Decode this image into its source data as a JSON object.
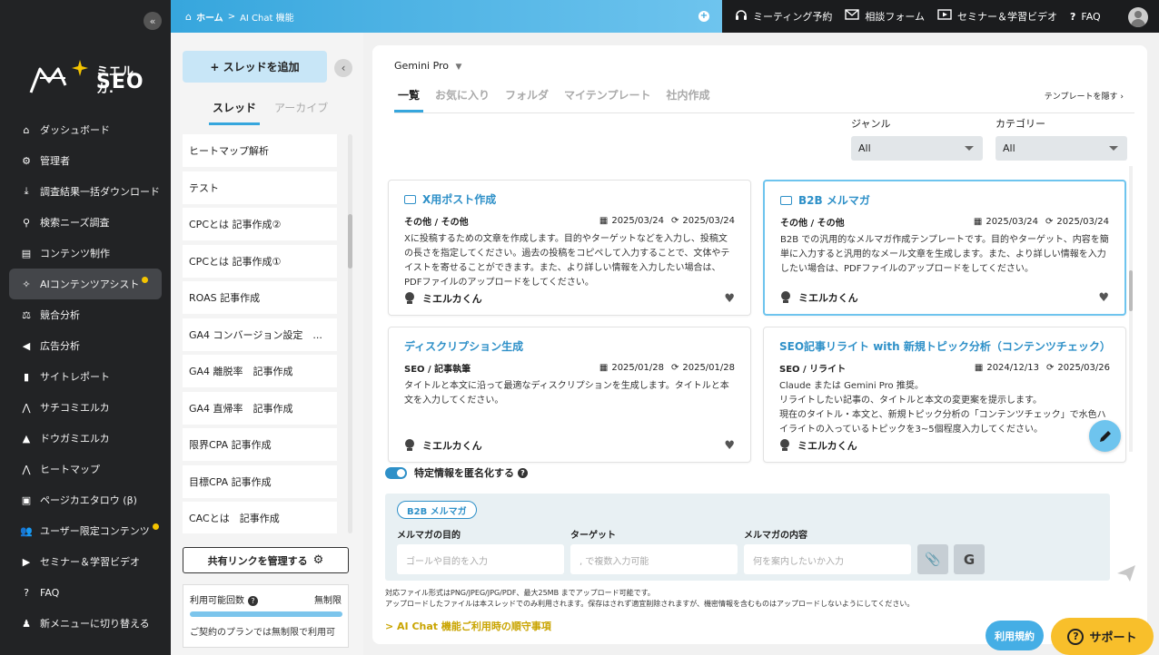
{
  "sidebar": {
    "collapse_glyph": "«",
    "logo_line1": "ミエルカ.",
    "logo_line2": "SEO",
    "items": [
      {
        "label": "ダッシュボード",
        "icon": "home-icon",
        "glyph": "⌂"
      },
      {
        "label": "管理者",
        "icon": "gear-icon",
        "glyph": "⚙"
      },
      {
        "label": "調査結果一括ダウンロード",
        "icon": "download-icon",
        "glyph": "⤓"
      },
      {
        "label": "検索ニーズ調査",
        "icon": "search-icon",
        "glyph": "⚲"
      },
      {
        "label": "コンテンツ制作",
        "icon": "document-icon",
        "glyph": "▤"
      },
      {
        "label": "AIコンテンツアシスト",
        "icon": "magic-wand-icon",
        "glyph": "✧"
      },
      {
        "label": "競合分析",
        "icon": "scale-icon",
        "glyph": "⚖"
      },
      {
        "label": "広告分析",
        "icon": "megaphone-icon",
        "glyph": "◀"
      },
      {
        "label": "サイトレポート",
        "icon": "bar-chart-icon",
        "glyph": "▮"
      },
      {
        "label": "サチコミエルカ",
        "icon": "sachiko-icon",
        "glyph": "⋀"
      },
      {
        "label": "ドウガミエルカ",
        "icon": "douga-icon",
        "glyph": "▲"
      },
      {
        "label": "ヒートマップ",
        "icon": "heatmap-icon",
        "glyph": "⋀"
      },
      {
        "label": "ページカエタロウ (β)",
        "icon": "page-edit-icon",
        "glyph": "▣"
      },
      {
        "label": "ユーザー限定コンテンツ",
        "icon": "users-icon",
        "glyph": "👥"
      },
      {
        "label": "セミナー＆学習ビデオ",
        "icon": "video-icon",
        "glyph": "▶"
      },
      {
        "label": "FAQ",
        "icon": "question-icon",
        "glyph": "?"
      },
      {
        "label": "新メニューに切り替える",
        "icon": "switch-icon",
        "glyph": "♟"
      }
    ]
  },
  "topbar": {
    "breadcrumb_home": "ホーム",
    "breadcrumb_sep": ">",
    "breadcrumb_current": "AI Chat 機能",
    "add_glyph": "+",
    "links": [
      {
        "label": "ミーティング予約",
        "icon": "headset-icon",
        "glyph": "🎧"
      },
      {
        "label": "相談フォーム",
        "icon": "mail-icon",
        "glyph": "✉"
      },
      {
        "label": "セミナー＆学習ビデオ",
        "icon": "video-icon",
        "glyph": "▶"
      },
      {
        "label": "FAQ",
        "icon": "question-icon",
        "glyph": "?"
      }
    ]
  },
  "threads": {
    "add_label": "+ スレッドを追加",
    "collapse_glyph": "‹",
    "tabs": [
      "スレッド",
      "アーカイブ"
    ],
    "items": [
      "ヒートマップ解析",
      "テスト",
      "CPCとは 記事作成②",
      "CPCとは 記事作成①",
      "ROAS 記事作成",
      "GA4 コンバージョン設定　...",
      "GA4 離脱率　記事作成",
      "GA4 直帰率　記事作成",
      "限界CPA 記事作成",
      "目標CPA 記事作成",
      "CACとは　記事作成"
    ],
    "share_label": "共有リンクを管理する",
    "usage_label": "利用可能回数",
    "usage_value": "無制限",
    "usage_note": "ご契約のプランでは無制限で利用可"
  },
  "main": {
    "model": "Gemini Pro",
    "tabs": [
      "一覧",
      "お気に入り",
      "フォルダ",
      "マイテンプレート",
      "社内作成"
    ],
    "hide_template": "テンプレートを隠す",
    "genre_label": "ジャンル",
    "genre_value": "All",
    "category_label": "カテゴリー",
    "category_value": "All",
    "cards": [
      {
        "title": "X用ポスト作成",
        "category": "その他 / その他",
        "created": "2025/03/24",
        "updated": "2025/03/24",
        "desc": "Xに投稿するための文章を作成します。目的やターゲットなどを入力し、投稿文の長さを指定してください。過去の投稿をコピペして入力することで、文体やテイストを寄せることができます。また、より詳しい情報を入力したい場合は、PDFファイルのアップロードをしてください。",
        "author": "ミエルカくん"
      },
      {
        "title": "B2B メルマガ",
        "category": "その他 / その他",
        "created": "2025/03/24",
        "updated": "2025/03/24",
        "desc": "B2B での汎用的なメルマガ作成テンプレートです。目的やターゲット、内容を簡単に入力すると汎用的なメール文章を生成します。また、より詳しい情報を入力したい場合は、PDFファイルのアップロードをしてください。",
        "author": "ミエルカくん"
      },
      {
        "title": "ディスクリプション生成",
        "category": "SEO / 記事執筆",
        "created": "2025/01/28",
        "updated": "2025/01/28",
        "desc": "タイトルと本文に沿って最適なディスクリプションを生成します。タイトルと本文を入力してください。",
        "author": "ミエルカくん"
      },
      {
        "title": "SEO記事リライト with 新規トピック分析（コンテンツチェック）",
        "category": "SEO / リライト",
        "created": "2024/12/13",
        "updated": "2025/03/26",
        "desc": "Claude または Gemini Pro 推奨。\nリライトしたい記事の、タイトルと本文の変更案を提示します。\n現在のタイトル・本文と、新規トピック分析の「コンテンツチェック」で水色ハイライトの入っているトピックを3~5個程度入力してください。",
        "author": "ミエルカくん"
      }
    ],
    "anonymize_label": "特定情報を匿名化する",
    "selected_chip": "B2B メルマガ",
    "fields": [
      {
        "label": "メルマガの目的",
        "placeholder": "ゴールや目的を入力"
      },
      {
        "label": "ターゲット",
        "placeholder": ", で複数入力可能"
      },
      {
        "label": "メルマガの内容",
        "placeholder": "何を案内したいか入力"
      }
    ],
    "notice_line1": "対応ファイル形式はPNG/JPEG/JPG/PDF、最大25MB までアップロード可能です。",
    "notice_line2": "アップロードしたファイルは本スレッドでのみ利用されます。保存はされず適宜削除されますが、機密情報を含むものはアップロードしないようにしてください。",
    "compliance": "> AI Chat 機能ご利用時の順守事項"
  },
  "floating": {
    "terms": "利用規約",
    "support": "サポート"
  },
  "colors": {
    "accent": "#36a6dd",
    "sidebar_bg": "#222325",
    "support": "#f8bf2b",
    "compliance": "#c9a400"
  }
}
